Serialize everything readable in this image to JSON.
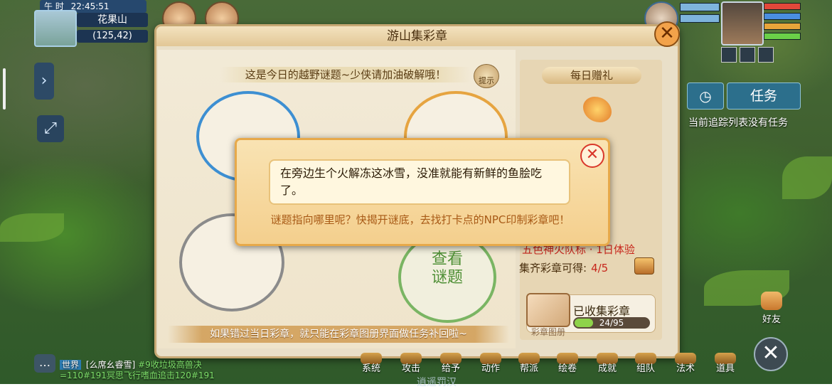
{
  "status": {
    "period": "午 时",
    "time": "22:45:51",
    "location": "花果山",
    "coords": "(125,42)"
  },
  "hud": {
    "task_button": "任务",
    "task_empty": "当前追踪列表没有任务",
    "friends": "好友"
  },
  "panel": {
    "title": "游山集彩章",
    "hint_text": "这是今日的越野谜题~少侠请加油破解哦！",
    "hint_button": "提示",
    "check_riddle": [
      "查看",
      "谜题"
    ],
    "footnote": "如果错过当日彩章，就只能在彩章图册界面做任务补回啦~"
  },
  "reward": {
    "daily_label": "每日赠礼",
    "item_name": "五色神火队标 · 1日体验",
    "collect_label": "集齐彩章可得:",
    "collect_count": "4/5"
  },
  "album": {
    "label": "已收集彩章",
    "caption": "彩章图册",
    "progress_text": "24/95",
    "progress_value": 24,
    "progress_max": 95
  },
  "popup": {
    "riddle": "在旁边生个火解冻这冰雪，没准就能有新鲜的鱼脍吃了。",
    "tip": "谜题指向哪里呢？快揭开谜底，去找打卡点的NPC印制彩章吧！"
  },
  "bottom_bar": {
    "items": [
      "系统",
      "攻击",
      "给予",
      "动作",
      "帮派",
      "绘卷",
      "成就",
      "组队",
      "法术",
      "道具"
    ],
    "faded_label": "逍遥罚汉"
  },
  "chat": {
    "channel": "世界",
    "sender": "[么席幺睿雪]",
    "line1": "#9收垃圾高兽决",
    "line2": "=110#191冥思飞行嗜血追击120#191"
  },
  "colors": {
    "panel_bg": "#e9dfc8",
    "accent_red": "#c7261c",
    "hud_blue": "#2c6f8c",
    "progress_green": "#8ed34a"
  }
}
